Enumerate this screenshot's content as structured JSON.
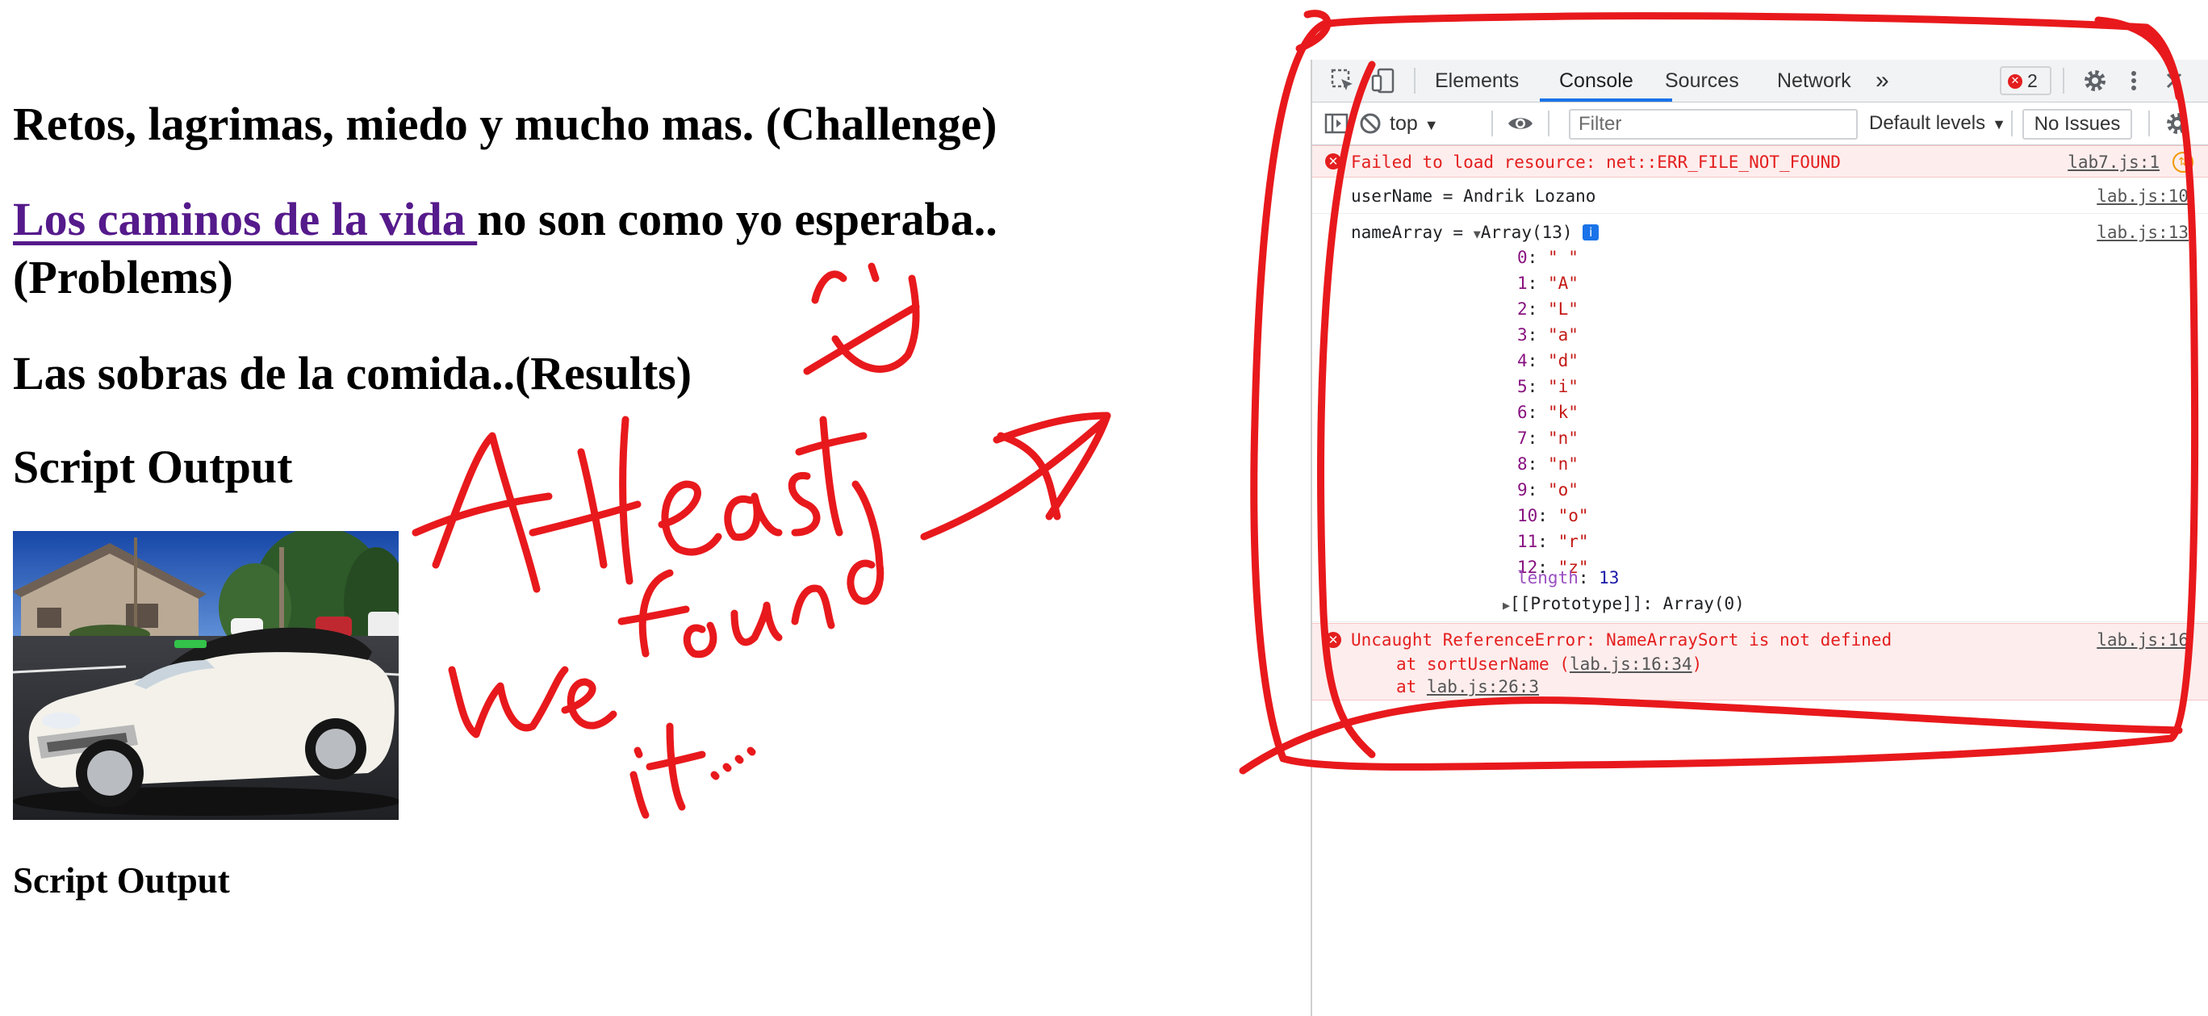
{
  "page": {
    "heading_challenge": "Retos, lagrimas, miedo y mucho mas. (Challenge)",
    "problems_link": "Los caminos de la vida ",
    "problems_rest": "no son como yo esperaba.. (Problems)",
    "heading_results": "Las sobras de la comida..(Results)",
    "heading_script_output": "Script Output",
    "heading_script_output_2": "Script Output"
  },
  "annotation": {
    "handwritten_text": "At least we found it....",
    "ink_color": "#e8191c"
  },
  "devtools": {
    "tabs": [
      "Elements",
      "Console",
      "Sources",
      "Network"
    ],
    "active_tab": "Console",
    "more_tabs": "»",
    "error_count": "2",
    "context": "top",
    "filter_placeholder": "Filter",
    "levels": "Default levels",
    "issues": "No Issues"
  },
  "console": {
    "error1": {
      "text": "Failed to load resource: net::ERR_FILE_NOT_FOUND",
      "source": "lab7.js:1"
    },
    "log_username": {
      "text": "userName = Andrik Lozano",
      "source": "lab.js:10"
    },
    "log_namearray": {
      "prefix": "nameArray = ",
      "summary": "Array(13)",
      "source": "lab.js:13",
      "items": [
        {
          "index": "0",
          "value": "\" \""
        },
        {
          "index": "1",
          "value": "\"A\""
        },
        {
          "index": "2",
          "value": "\"L\""
        },
        {
          "index": "3",
          "value": "\"a\""
        },
        {
          "index": "4",
          "value": "\"d\""
        },
        {
          "index": "5",
          "value": "\"i\""
        },
        {
          "index": "6",
          "value": "\"k\""
        },
        {
          "index": "7",
          "value": "\"n\""
        },
        {
          "index": "8",
          "value": "\"n\""
        },
        {
          "index": "9",
          "value": "\"o\""
        },
        {
          "index": "10",
          "value": "\"o\""
        },
        {
          "index": "11",
          "value": "\"r\""
        },
        {
          "index": "12",
          "value": "\"z\""
        }
      ],
      "length_label": "length",
      "length_value": "13",
      "prototype_label": "[[Prototype]]: Array(0)"
    },
    "error2": {
      "text": "Uncaught ReferenceError: NameArraySort is not defined",
      "source": "lab.js:16",
      "trace1_prefix": "at sortUserName (",
      "trace1_link": "lab.js:16:34",
      "trace1_suffix": ")",
      "trace2_prefix": "at ",
      "trace2_link": "lab.js:26:3"
    }
  }
}
